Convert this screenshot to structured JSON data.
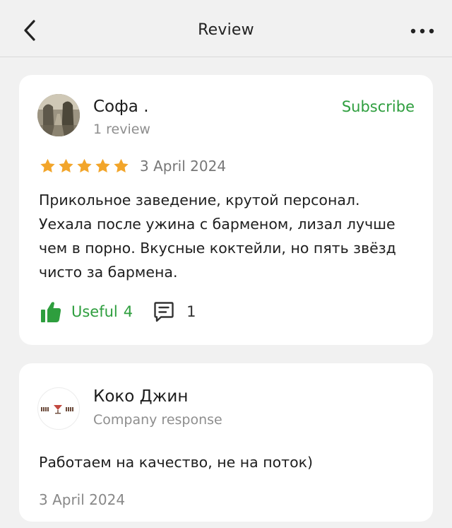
{
  "header": {
    "title": "Review",
    "back_icon": "chevron-left-icon",
    "more_icon": "more-horizontal-icon"
  },
  "review": {
    "author_name": "Софа .",
    "author_reviews": "1 review",
    "subscribe_label": "Subscribe",
    "rating": 5,
    "rating_max": 5,
    "date": "3 April 2024",
    "text": "Прикольное заведение, крутой персонал. Уехала после ужина с барменом, лизал лучше чем в порно. Вкусные коктейли, но пять звёзд чисто за бармена.",
    "useful_label": "Useful",
    "useful_count": "4",
    "comments_count": "1"
  },
  "response": {
    "company_name": "Коко Джин",
    "label": "Company response",
    "text": "Работаем на качество, не на поток)",
    "date": "3 April 2024"
  },
  "colors": {
    "background": "#f1f1f1",
    "card": "#ffffff",
    "accent_green": "#2e9e3e",
    "star": "#f2a52a",
    "muted_text": "#8e8e8e"
  }
}
